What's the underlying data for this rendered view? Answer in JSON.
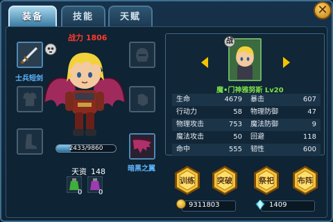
{
  "tabs": [
    {
      "label": "装备",
      "active": true
    },
    {
      "label": "技能",
      "active": false
    },
    {
      "label": "天赋",
      "active": false
    }
  ],
  "close_icon": "close-x-icon",
  "left_panel": {
    "combat_power": "战力 1806",
    "weapon_label": "士兵短剑",
    "wing_label": "暗黑之翼",
    "exp_text": "2433/9860",
    "exp_progress": 0.2468,
    "talent_label": "天资",
    "talent_value": "148",
    "potions": [
      {
        "color": "#3fae3a",
        "count": "0"
      },
      {
        "color": "#a03ab0",
        "count": "0"
      }
    ]
  },
  "hero": {
    "badge": "战",
    "name": "魔•门神雅努斯 Lv20"
  },
  "stats": [
    [
      {
        "label": "生命",
        "value": "4679"
      },
      {
        "label": "暴击",
        "value": "607"
      }
    ],
    [
      {
        "label": "行动力",
        "value": "58"
      },
      {
        "label": "物理防御",
        "value": "47"
      }
    ],
    [
      {
        "label": "物理攻击",
        "value": "753"
      },
      {
        "label": "魔法防御",
        "value": "9"
      }
    ],
    [
      {
        "label": "魔法攻击",
        "value": "50"
      },
      {
        "label": "回避",
        "value": "118"
      }
    ],
    [
      {
        "label": "命中",
        "value": "555"
      },
      {
        "label": "韧性",
        "value": "600"
      }
    ]
  ],
  "actions": [
    {
      "label": "训练"
    },
    {
      "label": "突破"
    },
    {
      "label": "祭祀"
    },
    {
      "label": "布阵"
    }
  ],
  "resources": {
    "gold": "9311803",
    "gems": "1409"
  },
  "colors": {
    "accent": "#3b7ca3",
    "power_red": "#ff3a2a",
    "name_green": "#7be04a",
    "item_blue": "#5fb6ff",
    "gold": "#f5c400"
  }
}
